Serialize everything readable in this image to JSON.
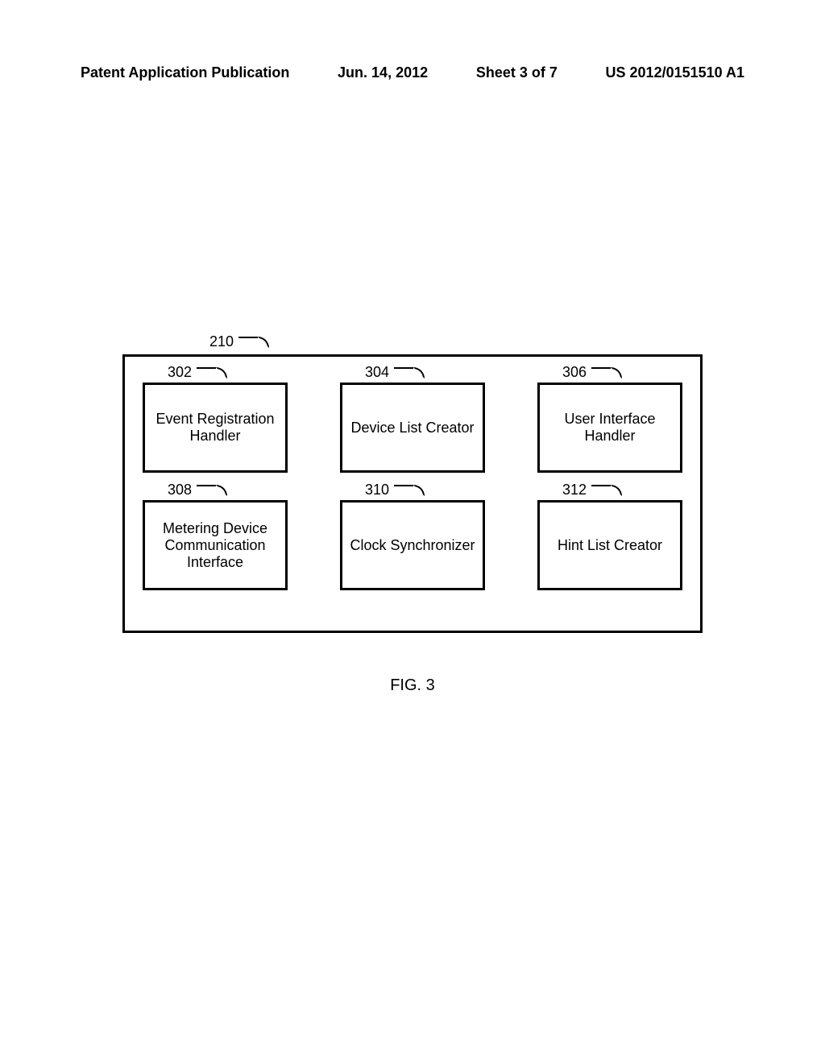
{
  "header": {
    "publication": "Patent Application Publication",
    "date": "Jun. 14, 2012",
    "sheet": "Sheet 3 of 7",
    "docnum": "US 2012/0151510 A1"
  },
  "outer": {
    "ref": "210"
  },
  "boxes": {
    "b302": {
      "ref": "302",
      "label": "Event Registration Handler"
    },
    "b304": {
      "ref": "304",
      "label": "Device List Creator"
    },
    "b306": {
      "ref": "306",
      "label": "User Interface Handler"
    },
    "b308": {
      "ref": "308",
      "label": "Metering Device Communication Interface"
    },
    "b310": {
      "ref": "310",
      "label": "Clock Synchronizer"
    },
    "b312": {
      "ref": "312",
      "label": "Hint List Creator"
    }
  },
  "caption": "FIG. 3"
}
